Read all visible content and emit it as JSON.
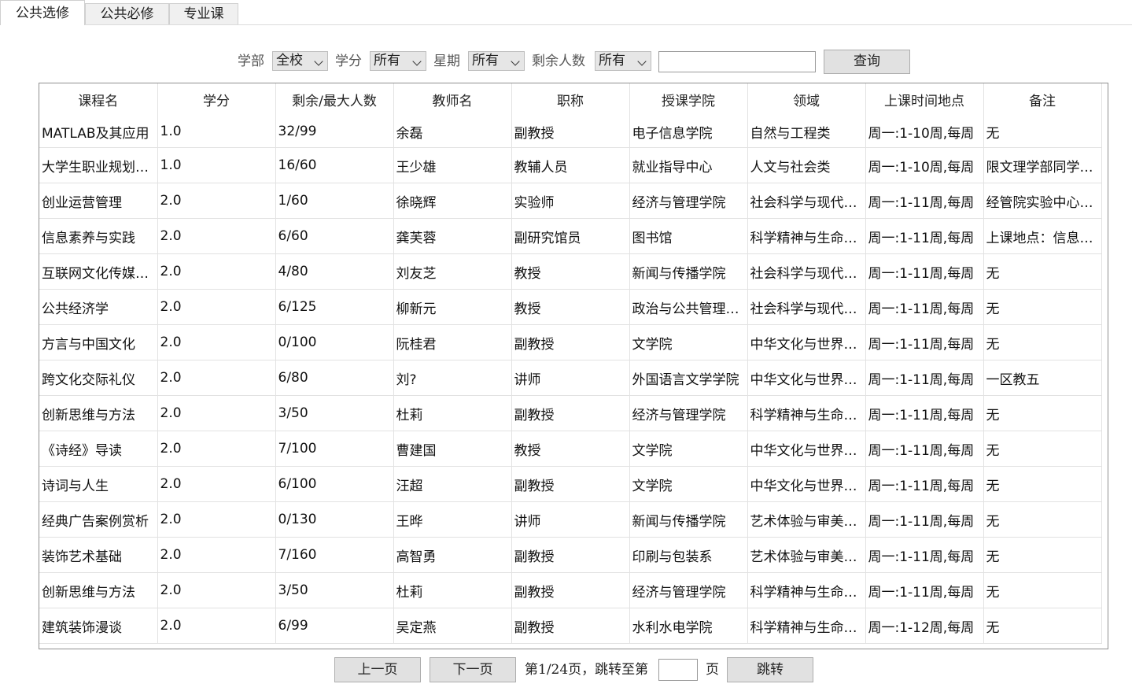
{
  "tabs": [
    {
      "label": "公共选修"
    },
    {
      "label": "公共必修"
    },
    {
      "label": "专业课"
    }
  ],
  "filters": {
    "department_label": "学部",
    "department_value": "全校",
    "credit_label": "学分",
    "credit_value": "所有",
    "weekday_label": "星期",
    "weekday_value": "所有",
    "remaining_label": "剩余人数",
    "remaining_value": "所有",
    "search_value": "",
    "query_button": "查询"
  },
  "table": {
    "headers": [
      "课程名",
      "学分",
      "剩余/最大人数",
      "教师名",
      "职称",
      "授课学院",
      "领域",
      "上课时间地点",
      "备注"
    ],
    "rows": [
      [
        "MATLAB及其应用",
        "1.0",
        "32/99",
        "余磊",
        "副教授",
        "电子信息学院",
        "自然与工程类",
        "周一:1-10周,每周",
        "无"
      ],
      [
        "大学生职业规划与就业指导",
        "1.0",
        "16/60",
        "王少雄",
        "教辅人员",
        "就业指导中心",
        "人文与社会类",
        "周一:1-10周,每周",
        "限文理学部同学选修"
      ],
      [
        "创业运营管理",
        "2.0",
        "1/60",
        "徐晓辉",
        "实验师",
        "经济与管理学院",
        "社会科学与现代社会",
        "周一:1-11周,每周",
        "经管院实验中心上课"
      ],
      [
        "信息素养与实践",
        "2.0",
        "6/60",
        "龚芙蓉",
        "副研究馆员",
        "图书馆",
        "科学精神与生命关怀",
        "周一:1-11周,每周",
        "上课地点：信息学部"
      ],
      [
        "互联网文化传媒与社会",
        "2.0",
        "4/80",
        "刘友芝",
        "教授",
        "新闻与传播学院",
        "社会科学与现代社会",
        "周一:1-11周,每周",
        "无"
      ],
      [
        "公共经济学",
        "2.0",
        "6/125",
        "柳新元",
        "教授",
        "政治与公共管理学院",
        "社会科学与现代社会",
        "周一:1-11周,每周",
        "无"
      ],
      [
        "方言与中国文化",
        "2.0",
        "0/100",
        "阮桂君",
        "副教授",
        "文学院",
        "中华文化与世界文明",
        "周一:1-11周,每周",
        "无"
      ],
      [
        "跨文化交际礼仪",
        "2.0",
        "6/80",
        "刘?",
        "讲师",
        "外国语言文学学院",
        "中华文化与世界文明",
        "周一:1-11周,每周",
        "一区教五"
      ],
      [
        "创新思维与方法",
        "2.0",
        "3/50",
        "杜莉",
        "副教授",
        "经济与管理学院",
        "科学精神与生命关怀",
        "周一:1-11周,每周",
        "无"
      ],
      [
        "《诗经》导读",
        "2.0",
        "7/100",
        "曹建国",
        "教授",
        "文学院",
        "中华文化与世界文明",
        "周一:1-11周,每周",
        "无"
      ],
      [
        "诗词与人生",
        "2.0",
        "6/100",
        "汪超",
        "副教授",
        "文学院",
        "中华文化与世界文明",
        "周一:1-11周,每周",
        "无"
      ],
      [
        "经典广告案例赏析",
        "2.0",
        "0/130",
        "王晔",
        "讲师",
        "新闻与传播学院",
        "艺术体验与审美鉴赏",
        "周一:1-11周,每周",
        "无"
      ],
      [
        "装饰艺术基础",
        "2.0",
        "7/160",
        "高智勇",
        "副教授",
        "印刷与包装系",
        "艺术体验与审美鉴赏",
        "周一:1-11周,每周",
        "无"
      ],
      [
        "创新思维与方法",
        "2.0",
        "3/50",
        "杜莉",
        "副教授",
        "经济与管理学院",
        "科学精神与生命关怀",
        "周一:1-11周,每周",
        "无"
      ],
      [
        "建筑装饰漫谈",
        "2.0",
        "6/99",
        "吴定燕",
        "副教授",
        "水利水电学院",
        "科学精神与生命关怀",
        "周一:1-12周,每周",
        "无"
      ]
    ]
  },
  "pager": {
    "prev_button": "上一页",
    "next_button": "下一页",
    "page_info": "第1/24页，跳转至第",
    "page_input_value": "",
    "page_suffix": "页",
    "jump_button": "跳转"
  }
}
